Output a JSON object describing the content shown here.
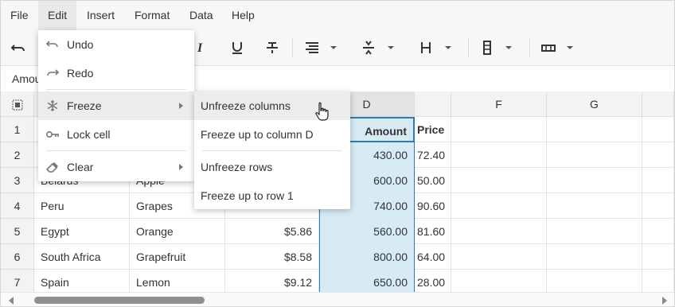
{
  "menubar": {
    "items": [
      {
        "label": "File"
      },
      {
        "label": "Edit"
      },
      {
        "label": "Insert"
      },
      {
        "label": "Format"
      },
      {
        "label": "Data"
      },
      {
        "label": "Help"
      }
    ],
    "active": "Edit"
  },
  "formula_bar": {
    "value": "Amount"
  },
  "grid": {
    "columns": [
      "D",
      "F",
      "G"
    ],
    "rows": [
      "1",
      "2",
      "3",
      "4",
      "5",
      "6",
      "7"
    ],
    "header_row": {
      "d": "Amount",
      "e": "Price"
    },
    "data": [
      {
        "a": "",
        "b": "",
        "c": "",
        "d": "430.00",
        "e": "72.40"
      },
      {
        "a": "Belarus",
        "b": "Apple",
        "c": "",
        "d": "600.00",
        "e": "50.00"
      },
      {
        "a": "Peru",
        "b": "Grapes",
        "c": "",
        "d": "740.00",
        "e": "90.60"
      },
      {
        "a": "Egypt",
        "b": "Orange",
        "c": "$5.86",
        "d": "560.00",
        "e": "81.60"
      },
      {
        "a": "South Africa",
        "b": "Grapefruit",
        "c": "$8.58",
        "d": "800.00",
        "e": "64.00"
      },
      {
        "a": "Spain",
        "b": "Lemon",
        "c": "$9.12",
        "d": "650.00",
        "e": "28.00"
      }
    ]
  },
  "edit_menu": {
    "undo": "Undo",
    "redo": "Redo",
    "freeze": "Freeze",
    "lock_cell": "Lock cell",
    "clear": "Clear"
  },
  "freeze_submenu": {
    "unfreeze_columns": "Unfreeze columns",
    "freeze_up_to_column": "Freeze up to column D",
    "unfreeze_rows": "Unfreeze rows",
    "freeze_up_to_row": "Freeze up to row 1"
  },
  "colors": {
    "selection": "#d7ebf5",
    "selection_border": "#2b7bb9",
    "menu_hover": "#ececec",
    "header_bg": "#f3f3f3"
  },
  "icons": [
    "undo-icon",
    "italic-icon",
    "underline-icon",
    "strikethrough-icon",
    "align-icon",
    "vertical-align-icon",
    "text-wrap-icon",
    "column-icon",
    "merge-icon",
    "select-all-icon",
    "redo-icon",
    "snowflake-icon",
    "key-icon",
    "eraser-icon",
    "hand-cursor-icon"
  ]
}
